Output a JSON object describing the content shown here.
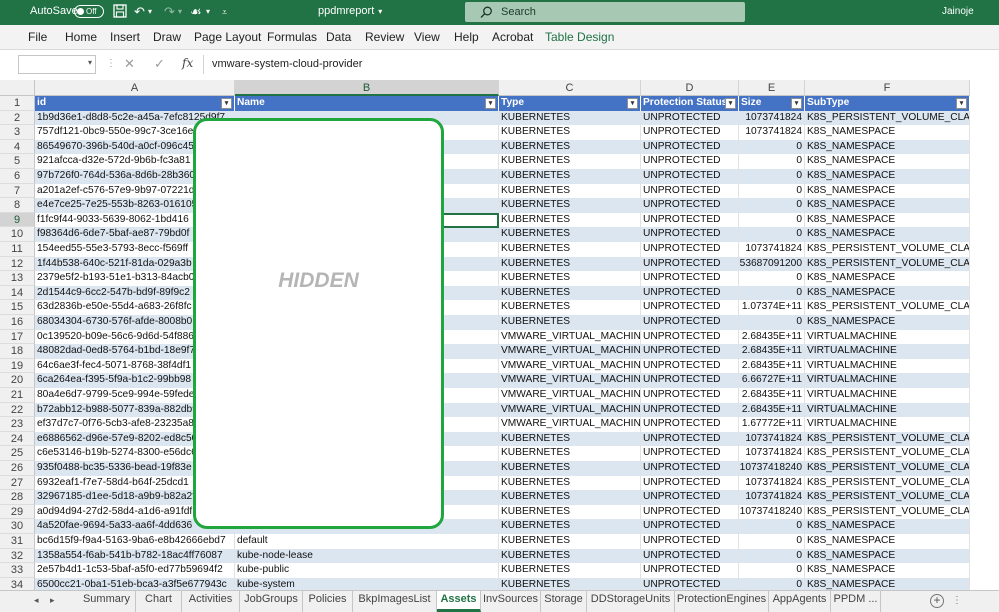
{
  "title_bar": {
    "autosave_label": "AutoSave",
    "autosave_state": "Off",
    "document_name": "ppdmreport",
    "search_placeholder": "Search",
    "user": "Jainoje"
  },
  "menu": {
    "tabs": [
      "File",
      "Home",
      "Insert",
      "Draw",
      "Page Layout",
      "Formulas",
      "Data",
      "Review",
      "View",
      "Help",
      "Acrobat",
      "Table Design"
    ],
    "active": "Table Design"
  },
  "formula_bar": {
    "name_box": "",
    "content": "vmware-system-cloud-provider"
  },
  "columns": [
    "A",
    "B",
    "C",
    "D",
    "E",
    "F"
  ],
  "selected_column": "B",
  "selected_row": "9",
  "table": {
    "headers": [
      "id",
      "Name",
      "Type",
      "Protection Status",
      "Size",
      "SubType"
    ],
    "rows": [
      [
        "1b9d36e1-d8d8-5c2e-a45a-7efc8125d9f7",
        "",
        "KUBERNETES",
        "UNPROTECTED",
        "1073741824",
        "K8S_PERSISTENT_VOLUME_CLAIM"
      ],
      [
        "757df121-0bc9-550e-99c7-3ce16e",
        "",
        "KUBERNETES",
        "UNPROTECTED",
        "1073741824",
        "K8S_NAMESPACE"
      ],
      [
        "86549670-396b-540d-a0cf-096c45",
        "",
        "KUBERNETES",
        "UNPROTECTED",
        "0",
        "K8S_NAMESPACE"
      ],
      [
        "921afcca-d32e-572d-9b6b-fc3a81",
        "",
        "KUBERNETES",
        "UNPROTECTED",
        "0",
        "K8S_NAMESPACE"
      ],
      [
        "97b726f0-764d-536a-8d6b-28b360",
        "",
        "KUBERNETES",
        "UNPROTECTED",
        "0",
        "K8S_NAMESPACE"
      ],
      [
        "a201a2ef-c576-57e9-9b97-07221d",
        "",
        "KUBERNETES",
        "UNPROTECTED",
        "0",
        "K8S_NAMESPACE"
      ],
      [
        "e4e7ce25-7e25-553b-8263-016105",
        "",
        "KUBERNETES",
        "UNPROTECTED",
        "0",
        "K8S_NAMESPACE"
      ],
      [
        "f1fc9f44-9033-5639-8062-1bd416",
        "",
        "KUBERNETES",
        "UNPROTECTED",
        "0",
        "K8S_NAMESPACE"
      ],
      [
        "f98364d6-6de7-5baf-ae87-79bd0f",
        "",
        "KUBERNETES",
        "UNPROTECTED",
        "0",
        "K8S_NAMESPACE"
      ],
      [
        "154eed55-55e3-5793-8ecc-f569ff",
        "",
        "KUBERNETES",
        "UNPROTECTED",
        "1073741824",
        "K8S_PERSISTENT_VOLUME_CLAIM"
      ],
      [
        "1f44b538-640c-521f-81da-029a3b",
        "",
        "KUBERNETES",
        "UNPROTECTED",
        "53687091200",
        "K8S_PERSISTENT_VOLUME_CLAIM"
      ],
      [
        "2379e5f2-b193-51e1-b313-84acb0",
        "",
        "KUBERNETES",
        "UNPROTECTED",
        "0",
        "K8S_NAMESPACE"
      ],
      [
        "2d1544c9-6cc2-547b-bd9f-89f9c2",
        "",
        "KUBERNETES",
        "UNPROTECTED",
        "0",
        "K8S_NAMESPACE"
      ],
      [
        "63d2836b-e50e-55d4-a683-26f8fc",
        "",
        "KUBERNETES",
        "UNPROTECTED",
        "1.07374E+11",
        "K8S_PERSISTENT_VOLUME_CLAIM"
      ],
      [
        "68034304-6730-576f-afde-8008b0",
        "",
        "KUBERNETES",
        "UNPROTECTED",
        "0",
        "K8S_NAMESPACE"
      ],
      [
        "0c139520-b09e-56c6-9d6d-54f886",
        "",
        "VMWARE_VIRTUAL_MACHINE",
        "UNPROTECTED",
        "2.68435E+11",
        "VIRTUALMACHINE"
      ],
      [
        "48082dad-0ed8-5764-b1bd-18e9f7",
        "",
        "VMWARE_VIRTUAL_MACHINE",
        "UNPROTECTED",
        "2.68435E+11",
        "VIRTUALMACHINE"
      ],
      [
        "64c6ae3f-fec4-5071-8768-38f4df1",
        "",
        "VMWARE_VIRTUAL_MACHINE",
        "UNPROTECTED",
        "2.68435E+11",
        "VIRTUALMACHINE"
      ],
      [
        "6ca264ea-f395-5f9a-b1c2-99bb98",
        "",
        "VMWARE_VIRTUAL_MACHINE",
        "UNPROTECTED",
        "6.66727E+11",
        "VIRTUALMACHINE"
      ],
      [
        "80a4e6d7-9799-5ce9-994e-59fede",
        "",
        "VMWARE_VIRTUAL_MACHINE",
        "UNPROTECTED",
        "2.68435E+11",
        "VIRTUALMACHINE"
      ],
      [
        "b72abb12-b988-5077-839a-882db9",
        "",
        "VMWARE_VIRTUAL_MACHINE",
        "UNPROTECTED",
        "2.68435E+11",
        "VIRTUALMACHINE"
      ],
      [
        "ef37d7c7-0f76-5cb3-afe8-23235a8",
        "",
        "VMWARE_VIRTUAL_MACHINE",
        "UNPROTECTED",
        "1.67772E+11",
        "VIRTUALMACHINE"
      ],
      [
        "e6886562-d96e-57e9-8202-ed8c50",
        "",
        "KUBERNETES",
        "UNPROTECTED",
        "1073741824",
        "K8S_PERSISTENT_VOLUME_CLAIM"
      ],
      [
        "c6e53146-b19b-5274-8300-e56dc6",
        "",
        "KUBERNETES",
        "UNPROTECTED",
        "1073741824",
        "K8S_PERSISTENT_VOLUME_CLAIM"
      ],
      [
        "935f0488-bc35-5336-bead-19f83e",
        "",
        "KUBERNETES",
        "UNPROTECTED",
        "10737418240",
        "K8S_PERSISTENT_VOLUME_CLAIM"
      ],
      [
        "6932eaf1-f7e7-58d4-b64f-25dcd1",
        "",
        "KUBERNETES",
        "UNPROTECTED",
        "1073741824",
        "K8S_PERSISTENT_VOLUME_CLAIM"
      ],
      [
        "32967185-d1ee-5d18-a9b9-b82a2f",
        "",
        "KUBERNETES",
        "UNPROTECTED",
        "1073741824",
        "K8S_PERSISTENT_VOLUME_CLAIM"
      ],
      [
        "a0d94d94-27d2-58d4-a1d6-a91fdf",
        "",
        "KUBERNETES",
        "UNPROTECTED",
        "10737418240",
        "K8S_PERSISTENT_VOLUME_CLAIM"
      ],
      [
        "4a520fae-9694-5a33-aa6f-4dd636",
        "",
        "KUBERNETES",
        "UNPROTECTED",
        "0",
        "K8S_NAMESPACE"
      ],
      [
        "bc6d15f9-f9a4-5163-9ba6-e8b42666ebd7",
        "default",
        "KUBERNETES",
        "UNPROTECTED",
        "0",
        "K8S_NAMESPACE"
      ],
      [
        "1358a554-f6ab-541b-b782-18ac4ff76087",
        "kube-node-lease",
        "KUBERNETES",
        "UNPROTECTED",
        "0",
        "K8S_NAMESPACE"
      ],
      [
        "2e57b4d1-1c53-5baf-a5f0-ed77b59694f2",
        "kube-public",
        "KUBERNETES",
        "UNPROTECTED",
        "0",
        "K8S_NAMESPACE"
      ],
      [
        "6500cc21-0ba1-51eb-bca3-a3f5e677943c",
        "kube-system",
        "KUBERNETES",
        "UNPROTECTED",
        "0",
        "K8S_NAMESPACE"
      ]
    ]
  },
  "redaction_label": "HIDDEN",
  "sheet_tabs": [
    "Summary",
    "Chart",
    "Activities",
    "JobGroups",
    "Policies",
    "BkpImagesList",
    "Assets",
    "InvSources",
    "Storage",
    "DDStorageUnits",
    "ProtectionEngines",
    "AppAgents",
    "PPDM ..."
  ],
  "active_sheet": "Assets",
  "icons": {
    "save": "save-icon",
    "undo": "undo-icon",
    "redo": "redo-icon",
    "search": "search-icon",
    "cancel": "cancel-icon",
    "enter": "check-icon",
    "function": "fx-icon",
    "add_sheet": "plus-icon",
    "filter": "filter-dropdown-icon"
  },
  "colors": {
    "excel_green": "#217346",
    "table_header": "#4472c4",
    "table_band": "#dce6f1",
    "redaction_border": "#1fa63d"
  }
}
